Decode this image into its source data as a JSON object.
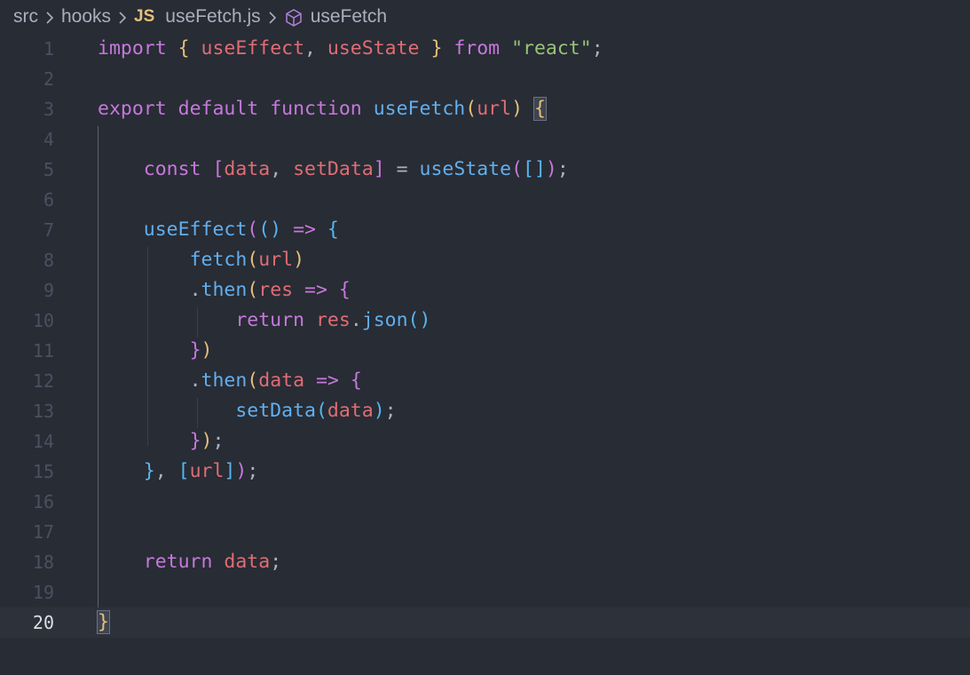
{
  "breadcrumb": {
    "items": [
      "src",
      "hooks"
    ],
    "file_icon": "JS",
    "file_name": "useFetch.js",
    "symbol_icon": "cube-icon",
    "symbol_name": "useFetch"
  },
  "editor": {
    "current_line": 20,
    "lines": [
      {
        "n": "1"
      },
      {
        "n": "2"
      },
      {
        "n": "3"
      },
      {
        "n": "4"
      },
      {
        "n": "5"
      },
      {
        "n": "6"
      },
      {
        "n": "7"
      },
      {
        "n": "8"
      },
      {
        "n": "9"
      },
      {
        "n": "10"
      },
      {
        "n": "11"
      },
      {
        "n": "12"
      },
      {
        "n": "13"
      },
      {
        "n": "14"
      },
      {
        "n": "15"
      },
      {
        "n": "16"
      },
      {
        "n": "17"
      },
      {
        "n": "18"
      },
      {
        "n": "19"
      },
      {
        "n": "20"
      }
    ],
    "tokens": {
      "l1": [
        {
          "t": "import",
          "c": "kw"
        },
        {
          "t": " ",
          "c": "punc"
        },
        {
          "t": "{",
          "c": "b1"
        },
        {
          "t": " ",
          "c": "punc"
        },
        {
          "t": "useEffect",
          "c": "var"
        },
        {
          "t": ", ",
          "c": "punc"
        },
        {
          "t": "useState",
          "c": "var"
        },
        {
          "t": " ",
          "c": "punc"
        },
        {
          "t": "}",
          "c": "b1"
        },
        {
          "t": " ",
          "c": "punc"
        },
        {
          "t": "from",
          "c": "kw"
        },
        {
          "t": " ",
          "c": "punc"
        },
        {
          "t": "\"react\"",
          "c": "str"
        },
        {
          "t": ";",
          "c": "punc"
        }
      ],
      "l3": [
        {
          "t": "export",
          "c": "kw"
        },
        {
          "t": " ",
          "c": "punc"
        },
        {
          "t": "default",
          "c": "kw"
        },
        {
          "t": " ",
          "c": "punc"
        },
        {
          "t": "function",
          "c": "kw"
        },
        {
          "t": " ",
          "c": "punc"
        },
        {
          "t": "useFetch",
          "c": "fn"
        },
        {
          "t": "(",
          "c": "b1"
        },
        {
          "t": "url",
          "c": "var"
        },
        {
          "t": ")",
          "c": "b1"
        },
        {
          "t": " ",
          "c": "punc"
        },
        {
          "t": "{",
          "c": "b1 bracket-match"
        }
      ],
      "l5": [
        {
          "t": "    ",
          "c": "punc"
        },
        {
          "t": "const",
          "c": "kw"
        },
        {
          "t": " ",
          "c": "punc"
        },
        {
          "t": "[",
          "c": "b2"
        },
        {
          "t": "data",
          "c": "var"
        },
        {
          "t": ", ",
          "c": "punc"
        },
        {
          "t": "setData",
          "c": "var"
        },
        {
          "t": "]",
          "c": "b2"
        },
        {
          "t": " = ",
          "c": "punc"
        },
        {
          "t": "useState",
          "c": "fn"
        },
        {
          "t": "(",
          "c": "b2"
        },
        {
          "t": "[]",
          "c": "b3"
        },
        {
          "t": ")",
          "c": "b2"
        },
        {
          "t": ";",
          "c": "punc"
        }
      ],
      "l7": [
        {
          "t": "    ",
          "c": "punc"
        },
        {
          "t": "useEffect",
          "c": "fn"
        },
        {
          "t": "(",
          "c": "b2"
        },
        {
          "t": "()",
          "c": "b3"
        },
        {
          "t": " ",
          "c": "punc"
        },
        {
          "t": "=>",
          "c": "kw"
        },
        {
          "t": " ",
          "c": "punc"
        },
        {
          "t": "{",
          "c": "b3"
        }
      ],
      "l8": [
        {
          "t": "        ",
          "c": "punc"
        },
        {
          "t": "fetch",
          "c": "fn"
        },
        {
          "t": "(",
          "c": "b1"
        },
        {
          "t": "url",
          "c": "var"
        },
        {
          "t": ")",
          "c": "b1"
        }
      ],
      "l9": [
        {
          "t": "        ",
          "c": "punc"
        },
        {
          "t": ".",
          "c": "punc"
        },
        {
          "t": "then",
          "c": "fn"
        },
        {
          "t": "(",
          "c": "b1"
        },
        {
          "t": "res",
          "c": "var"
        },
        {
          "t": " ",
          "c": "punc"
        },
        {
          "t": "=>",
          "c": "kw"
        },
        {
          "t": " ",
          "c": "punc"
        },
        {
          "t": "{",
          "c": "b2"
        }
      ],
      "l10": [
        {
          "t": "            ",
          "c": "punc"
        },
        {
          "t": "return",
          "c": "kw"
        },
        {
          "t": " ",
          "c": "punc"
        },
        {
          "t": "res",
          "c": "var"
        },
        {
          "t": ".",
          "c": "punc"
        },
        {
          "t": "json",
          "c": "fn"
        },
        {
          "t": "()",
          "c": "b3"
        }
      ],
      "l11": [
        {
          "t": "        ",
          "c": "punc"
        },
        {
          "t": "}",
          "c": "b2"
        },
        {
          "t": ")",
          "c": "b1"
        }
      ],
      "l12": [
        {
          "t": "        ",
          "c": "punc"
        },
        {
          "t": ".",
          "c": "punc"
        },
        {
          "t": "then",
          "c": "fn"
        },
        {
          "t": "(",
          "c": "b1"
        },
        {
          "t": "data",
          "c": "var"
        },
        {
          "t": " ",
          "c": "punc"
        },
        {
          "t": "=>",
          "c": "kw"
        },
        {
          "t": " ",
          "c": "punc"
        },
        {
          "t": "{",
          "c": "b2"
        }
      ],
      "l13": [
        {
          "t": "            ",
          "c": "punc"
        },
        {
          "t": "setData",
          "c": "fn"
        },
        {
          "t": "(",
          "c": "b3"
        },
        {
          "t": "data",
          "c": "var"
        },
        {
          "t": ")",
          "c": "b3"
        },
        {
          "t": ";",
          "c": "punc"
        }
      ],
      "l14": [
        {
          "t": "        ",
          "c": "punc"
        },
        {
          "t": "}",
          "c": "b2"
        },
        {
          "t": ")",
          "c": "b1"
        },
        {
          "t": ";",
          "c": "punc"
        }
      ],
      "l15": [
        {
          "t": "    ",
          "c": "punc"
        },
        {
          "t": "}",
          "c": "b3"
        },
        {
          "t": ", ",
          "c": "punc"
        },
        {
          "t": "[",
          "c": "b3"
        },
        {
          "t": "url",
          "c": "var"
        },
        {
          "t": "]",
          "c": "b3"
        },
        {
          "t": ")",
          "c": "b2"
        },
        {
          "t": ";",
          "c": "punc"
        }
      ],
      "l18": [
        {
          "t": "    ",
          "c": "punc"
        },
        {
          "t": "return",
          "c": "kw"
        },
        {
          "t": " ",
          "c": "punc"
        },
        {
          "t": "data",
          "c": "var"
        },
        {
          "t": ";",
          "c": "punc"
        }
      ],
      "l20": [
        {
          "t": "}",
          "c": "b1 bracket-match"
        }
      ]
    }
  }
}
